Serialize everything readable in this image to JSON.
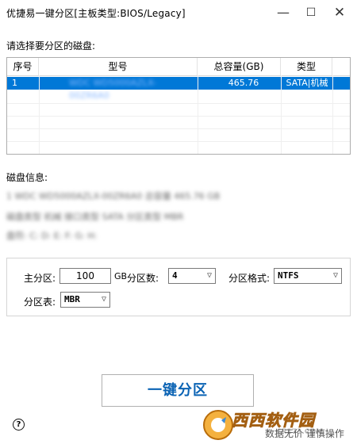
{
  "window": {
    "title": "优捷易一键分区[主板类型:BIOS/Legacy]",
    "minimize": "—",
    "maximize": "☐",
    "close": "✕"
  },
  "disk_select_label": "请选择要分区的磁盘:",
  "table": {
    "headers": [
      "序号",
      "型号",
      "总容量(GB)",
      "类型"
    ],
    "rows": [
      {
        "index": "1",
        "model": "WDC WD5000AZLX-00ZR6A0",
        "capacity": "465.76",
        "type": "SATA|机械"
      }
    ]
  },
  "disk_info": {
    "label": "磁盘信息:",
    "line1": "1 WDC WD5000AZLX-00ZR6A0 总容量 465.76 GB",
    "line2": "磁盘类型 机械  接口类型 SATA  分区类型 MBR",
    "line3": "盘符: C: D: E: F: G: H:"
  },
  "options": {
    "primary_label": "主分区:",
    "primary_value": "100",
    "primary_unit": "GB",
    "count_label": "分区数:",
    "count_value": "4",
    "format_label": "分区格式:",
    "format_value": "NTFS",
    "table_label": "分区表:",
    "table_value": "MBR"
  },
  "action_button": "一键分区",
  "help": "?",
  "watermark": {
    "brand": "西西软件园",
    "url": "CR173.COM",
    "caption": "数据无价 谨慎操作"
  },
  "colors": {
    "selection": "#0078d7",
    "button_text": "#0a63b4"
  }
}
